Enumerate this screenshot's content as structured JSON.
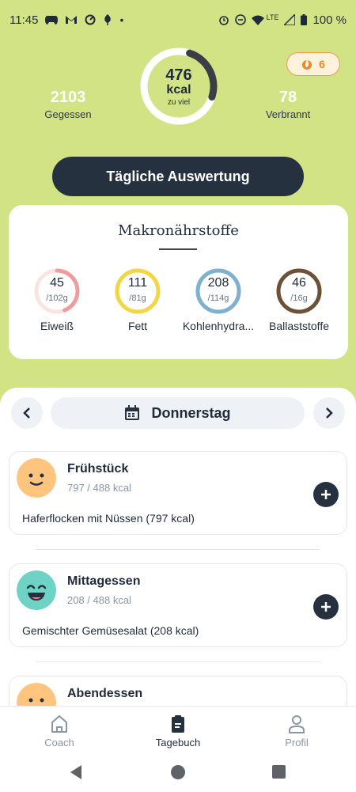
{
  "status_bar": {
    "time": "11:45",
    "network": "LTE",
    "battery": "100 %"
  },
  "summary": {
    "eaten_value": "2103",
    "eaten_label": "Gegessen",
    "burned_value": "78",
    "burned_label": "Verbrannt",
    "calories_value": "476",
    "calories_unit": "kcal",
    "calories_note": "zu viel",
    "streak": "6"
  },
  "evaluation_button": "Tägliche Auswertung",
  "macros": {
    "title": "Makronährstoffe",
    "items": [
      {
        "value": "45",
        "goal": "/102g",
        "label": "Eiweiß",
        "fraction": 0.44,
        "color": "#f19c9c",
        "track": "#fce3e3"
      },
      {
        "value": "111",
        "goal": "/81g",
        "label": "Fett",
        "fraction": 1.0,
        "color": "#f1d646",
        "track": "#fbf1b5"
      },
      {
        "value": "208",
        "goal": "/114g",
        "label": "Kohlenhydra...",
        "fraction": 1.0,
        "color": "#7fb1cf",
        "track": "#d6e8f3"
      },
      {
        "value": "46",
        "goal": "/16g",
        "label": "Ballaststoffe",
        "fraction": 1.0,
        "color": "#6b5136",
        "track": "#e3d9cf"
      }
    ]
  },
  "day": {
    "label": "Donnerstag"
  },
  "meals": [
    {
      "name": "Frühstück",
      "kcal": "797 / 488 kcal",
      "food": "Haferflocken mit Nüssen (797 kcal)",
      "face_color": "#ffc47e"
    },
    {
      "name": "Mittagessen",
      "kcal": "208 / 488 kcal",
      "food": "Gemischter Gemüsesalat (208 kcal)",
      "face_color": "#6ed3c4"
    },
    {
      "name": "Abendessen",
      "face_color": "#ffc47e"
    }
  ],
  "bottom_nav": {
    "coach": "Coach",
    "diary": "Tagebuch",
    "profile": "Profil"
  },
  "colors": {
    "background": "#d2e386",
    "dark": "#26313f",
    "accent_orange": "#e58a2e"
  }
}
